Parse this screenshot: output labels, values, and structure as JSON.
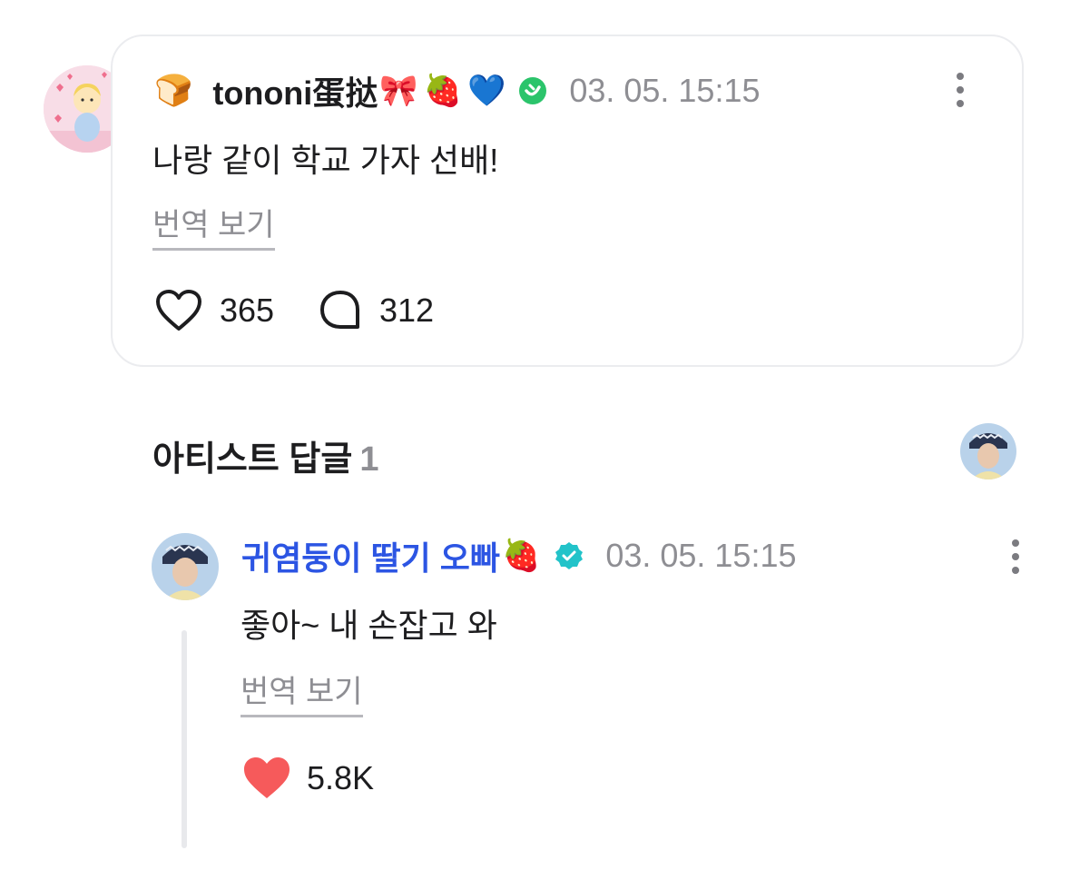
{
  "comment": {
    "author": "tononi蛋挞",
    "prefix_emoji": "🍞",
    "suffix_emojis": "🎀🍓💙",
    "date": "03. 05. 15:15",
    "text": "나랑 같이 학교 가자 선배!",
    "translate_label": "번역 보기",
    "likes": "365",
    "replies": "312",
    "icons": [
      "bread-emoji",
      "verified-fan-badge-icon",
      "more-icon",
      "heart-outline-icon",
      "comment-bubble-icon"
    ],
    "colors": {
      "badge": "#2bc46b",
      "card_border": "#ebecef"
    }
  },
  "artist_replies": {
    "title": "아티스트 답글",
    "count": "1"
  },
  "reply": {
    "author": "귀염둥이 딸기 오빠",
    "suffix_emoji": "🍓",
    "date": "03. 05. 15:15",
    "text": "좋아~ 내 손잡고 와",
    "translate_label": "번역 보기",
    "likes": "5.8K",
    "icons": [
      "verified-artist-badge-icon",
      "more-icon",
      "heart-filled-icon"
    ],
    "colors": {
      "author_name": "#2c55e3",
      "badge": "#22c3c9",
      "liked_heart": "#f65a5b"
    }
  }
}
